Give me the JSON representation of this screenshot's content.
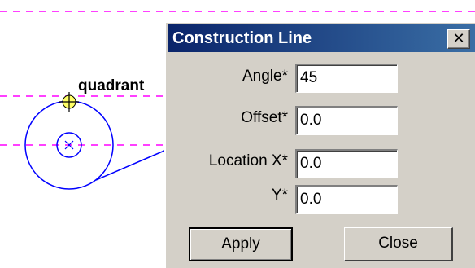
{
  "drawing": {
    "snap_label": "quadrant"
  },
  "dialog": {
    "title": "Construction Line",
    "close_glyph": "✕",
    "fields": {
      "angle": {
        "label": "Angle*",
        "value": "45"
      },
      "offset": {
        "label": "Offset*",
        "value": "0.0"
      },
      "location_x": {
        "label": "Location X*",
        "value": "0.0"
      },
      "location_y": {
        "label": "Y*",
        "value": "0.0"
      }
    },
    "buttons": {
      "apply": "Apply",
      "close": "Close"
    }
  },
  "colors": {
    "guide_line": "#ff00ff",
    "geometry": "#0000ff",
    "dialog_face": "#d4d0c8",
    "title_bar": "#0a246a"
  }
}
